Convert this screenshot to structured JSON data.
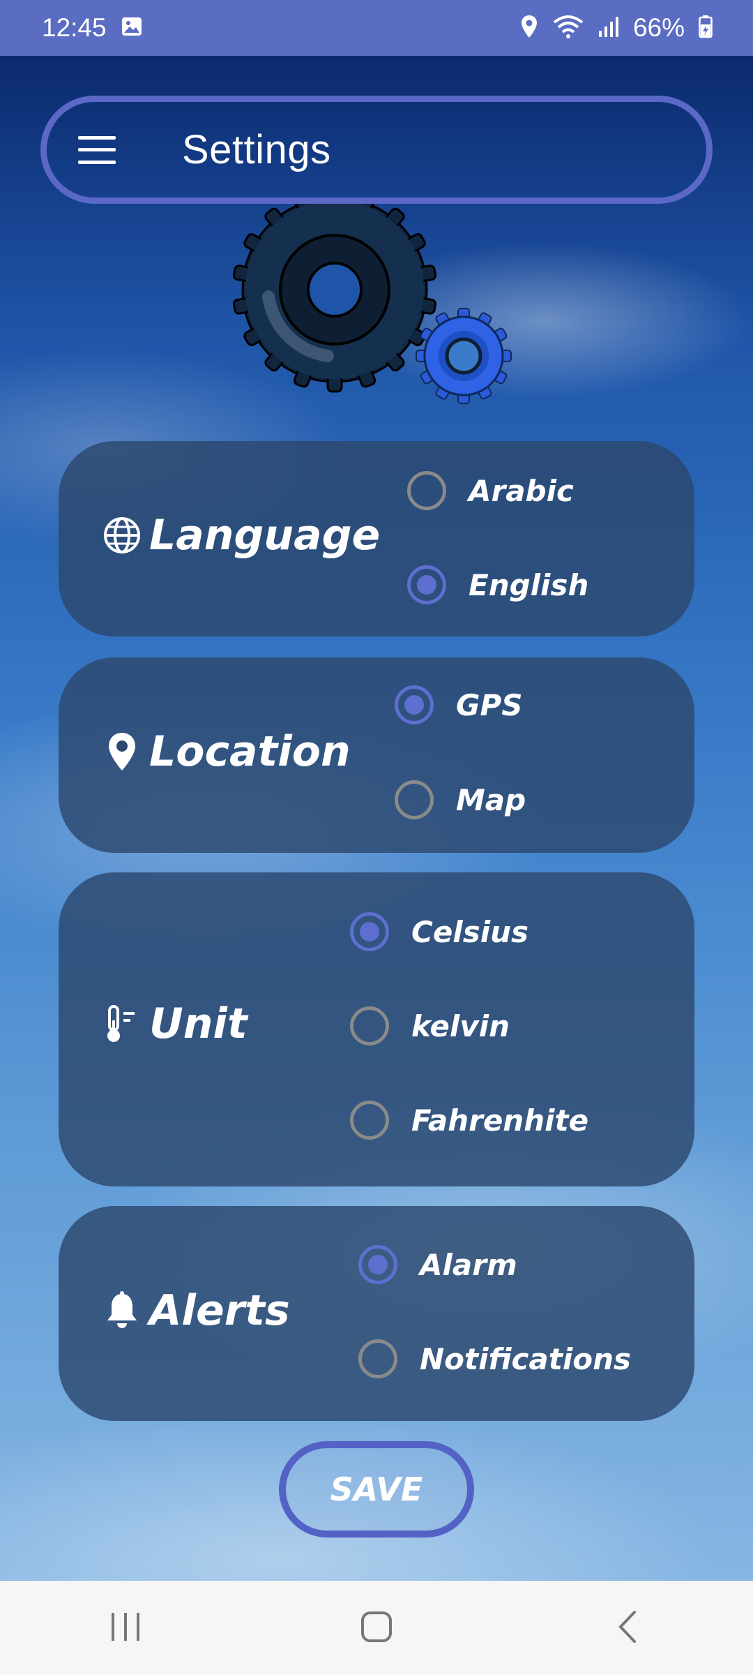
{
  "status_bar": {
    "time": "12:45",
    "battery": "66%",
    "icons": [
      "image-icon",
      "location-icon",
      "wifi-icon",
      "signal-icon",
      "battery-icon"
    ]
  },
  "app_bar": {
    "title": "Settings",
    "menu_icon": "hamburger-menu-icon"
  },
  "settings": {
    "language": {
      "label": "Language",
      "icon": "globe-icon",
      "options": [
        {
          "label": "Arabic",
          "selected": false
        },
        {
          "label": "English",
          "selected": true
        }
      ]
    },
    "location": {
      "label": "Location",
      "icon": "location-pin-icon",
      "options": [
        {
          "label": "GPS",
          "selected": true
        },
        {
          "label": "Map",
          "selected": false
        }
      ]
    },
    "unit": {
      "label": "Unit",
      "icon": "thermometer-icon",
      "options": [
        {
          "label": "Celsius",
          "selected": true
        },
        {
          "label": "kelvin",
          "selected": false
        },
        {
          "label": "Fahrenhite",
          "selected": false
        }
      ]
    },
    "alerts": {
      "label": "Alerts",
      "icon": "bell-icon",
      "options": [
        {
          "label": "Alarm",
          "selected": true
        },
        {
          "label": "Notifications",
          "selected": false
        }
      ]
    }
  },
  "save_button": {
    "label": "SAVE"
  },
  "colors": {
    "accent": "#5e6fd0",
    "status_bar": "#5a6dc2",
    "card": "#2c486e",
    "nav_bar": "#f6f6f6"
  }
}
